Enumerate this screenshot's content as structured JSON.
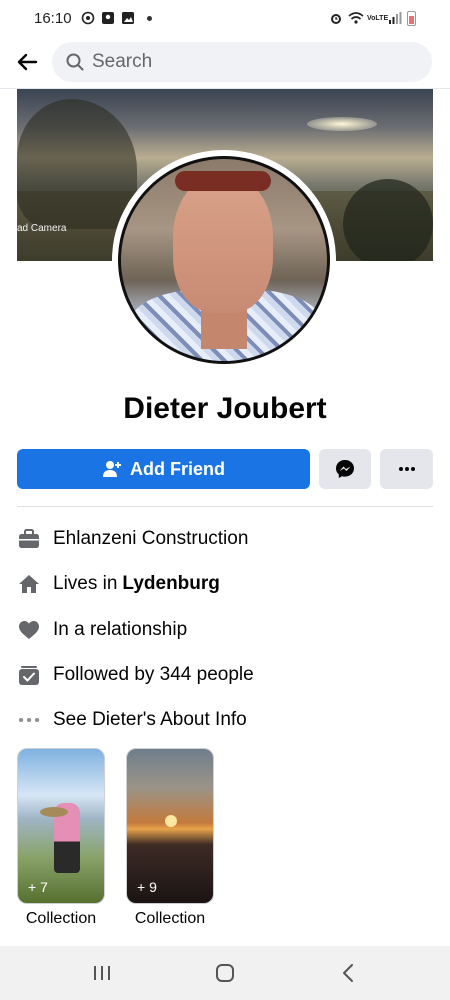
{
  "status_bar": {
    "time": "16:10",
    "left_icons": [
      "at-sign-icon",
      "shield-app-icon",
      "image-icon"
    ],
    "right_icons": [
      "alarm-icon",
      "wifi-icon",
      "volte-icon",
      "signal-icon",
      "battery-icon"
    ],
    "network_label": "VoLTE"
  },
  "header": {
    "search_placeholder": "Search"
  },
  "cover": {
    "caption": "ad Camera"
  },
  "profile": {
    "name": "Dieter Joubert"
  },
  "actions": {
    "add_friend_label": "Add Friend",
    "messenger_icon": "messenger-icon",
    "more_icon": "more-dots-icon",
    "primary_color": "#1b74e4"
  },
  "info": {
    "work": "Ehlanzeni Construction",
    "lives_prefix": "Lives in",
    "lives_city": "Lydenburg",
    "relationship": "In a relationship",
    "followers": "Followed by 344 people",
    "about": "See Dieter's About Info"
  },
  "collections": [
    {
      "count": "+ 7",
      "label": "Collection"
    },
    {
      "count": "+ 9",
      "label": "Collection"
    }
  ],
  "nav": {
    "recent_icon": "recent-apps-icon",
    "home_icon": "home-icon",
    "back_icon": "nav-back-icon"
  }
}
